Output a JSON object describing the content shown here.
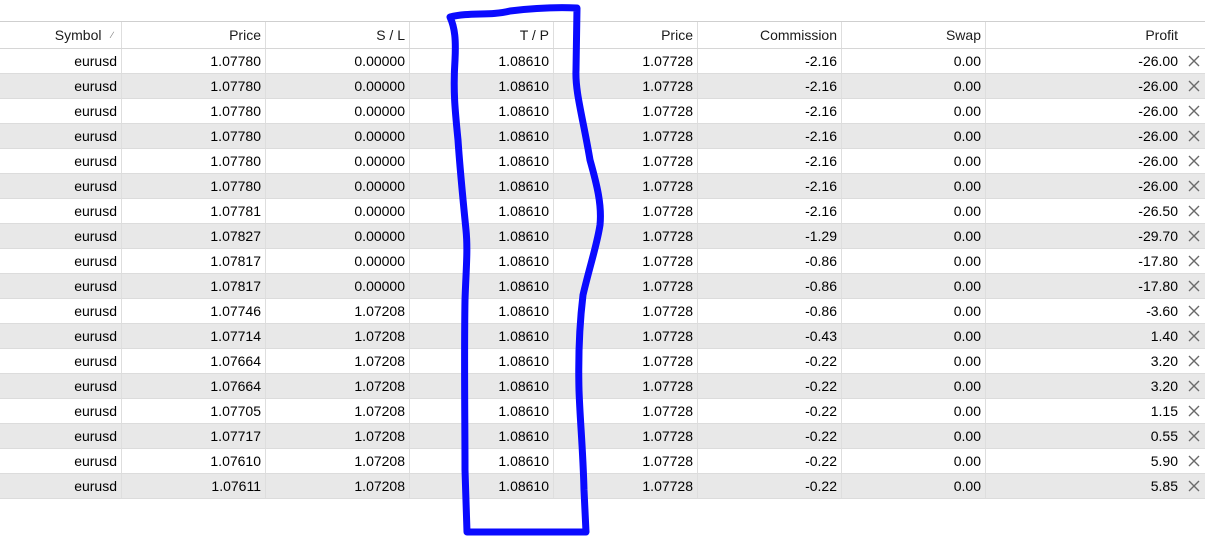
{
  "table": {
    "headers": [
      "Symbol",
      "Price",
      "S / L",
      "T / P",
      "Price",
      "Commission",
      "Swap",
      "Profit"
    ],
    "rows": [
      [
        "eurusd",
        "1.07780",
        "0.00000",
        "1.08610",
        "1.07728",
        "-2.16",
        "0.00",
        "-26.00"
      ],
      [
        "eurusd",
        "1.07780",
        "0.00000",
        "1.08610",
        "1.07728",
        "-2.16",
        "0.00",
        "-26.00"
      ],
      [
        "eurusd",
        "1.07780",
        "0.00000",
        "1.08610",
        "1.07728",
        "-2.16",
        "0.00",
        "-26.00"
      ],
      [
        "eurusd",
        "1.07780",
        "0.00000",
        "1.08610",
        "1.07728",
        "-2.16",
        "0.00",
        "-26.00"
      ],
      [
        "eurusd",
        "1.07780",
        "0.00000",
        "1.08610",
        "1.07728",
        "-2.16",
        "0.00",
        "-26.00"
      ],
      [
        "eurusd",
        "1.07780",
        "0.00000",
        "1.08610",
        "1.07728",
        "-2.16",
        "0.00",
        "-26.00"
      ],
      [
        "eurusd",
        "1.07781",
        "0.00000",
        "1.08610",
        "1.07728",
        "-2.16",
        "0.00",
        "-26.50"
      ],
      [
        "eurusd",
        "1.07827",
        "0.00000",
        "1.08610",
        "1.07728",
        "-1.29",
        "0.00",
        "-29.70"
      ],
      [
        "eurusd",
        "1.07817",
        "0.00000",
        "1.08610",
        "1.07728",
        "-0.86",
        "0.00",
        "-17.80"
      ],
      [
        "eurusd",
        "1.07817",
        "0.00000",
        "1.08610",
        "1.07728",
        "-0.86",
        "0.00",
        "-17.80"
      ],
      [
        "eurusd",
        "1.07746",
        "1.07208",
        "1.08610",
        "1.07728",
        "-0.86",
        "0.00",
        "-3.60"
      ],
      [
        "eurusd",
        "1.07714",
        "1.07208",
        "1.08610",
        "1.07728",
        "-0.43",
        "0.00",
        "1.40"
      ],
      [
        "eurusd",
        "1.07664",
        "1.07208",
        "1.08610",
        "1.07728",
        "-0.22",
        "0.00",
        "3.20"
      ],
      [
        "eurusd",
        "1.07664",
        "1.07208",
        "1.08610",
        "1.07728",
        "-0.22",
        "0.00",
        "3.20"
      ],
      [
        "eurusd",
        "1.07705",
        "1.07208",
        "1.08610",
        "1.07728",
        "-0.22",
        "0.00",
        "1.15"
      ],
      [
        "eurusd",
        "1.07717",
        "1.07208",
        "1.08610",
        "1.07728",
        "-0.22",
        "0.00",
        "0.55"
      ],
      [
        "eurusd",
        "1.07610",
        "1.07208",
        "1.08610",
        "1.07728",
        "-0.22",
        "0.00",
        "5.90"
      ],
      [
        "eurusd",
        "1.07611",
        "1.07208",
        "1.08610",
        "1.07728",
        "-0.22",
        "0.00",
        "5.85"
      ]
    ],
    "sort_indicator_icon": "sort-ascending-icon",
    "row_close_icon": "close-icon"
  },
  "annotation": {
    "shape": "hand-drawn rectangle around T / P column",
    "color": "#0a0aff"
  }
}
